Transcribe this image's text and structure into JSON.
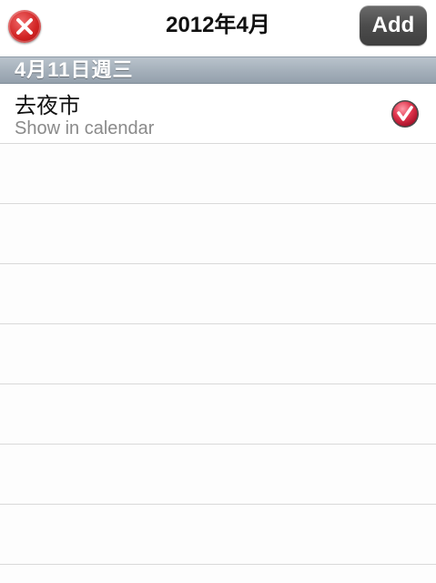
{
  "nav": {
    "title": "2012年4月",
    "add_label": "Add"
  },
  "icons": {
    "close": "close-icon",
    "checked": "check-icon"
  },
  "colors": {
    "close_red": "#d12424",
    "add_button_gray": "#4c4c4c",
    "section_header": "#a2adb8"
  },
  "section": {
    "date_label": "4月11日週三"
  },
  "events": [
    {
      "title": "去夜市",
      "subtitle": "Show in calendar",
      "checked": true
    }
  ]
}
